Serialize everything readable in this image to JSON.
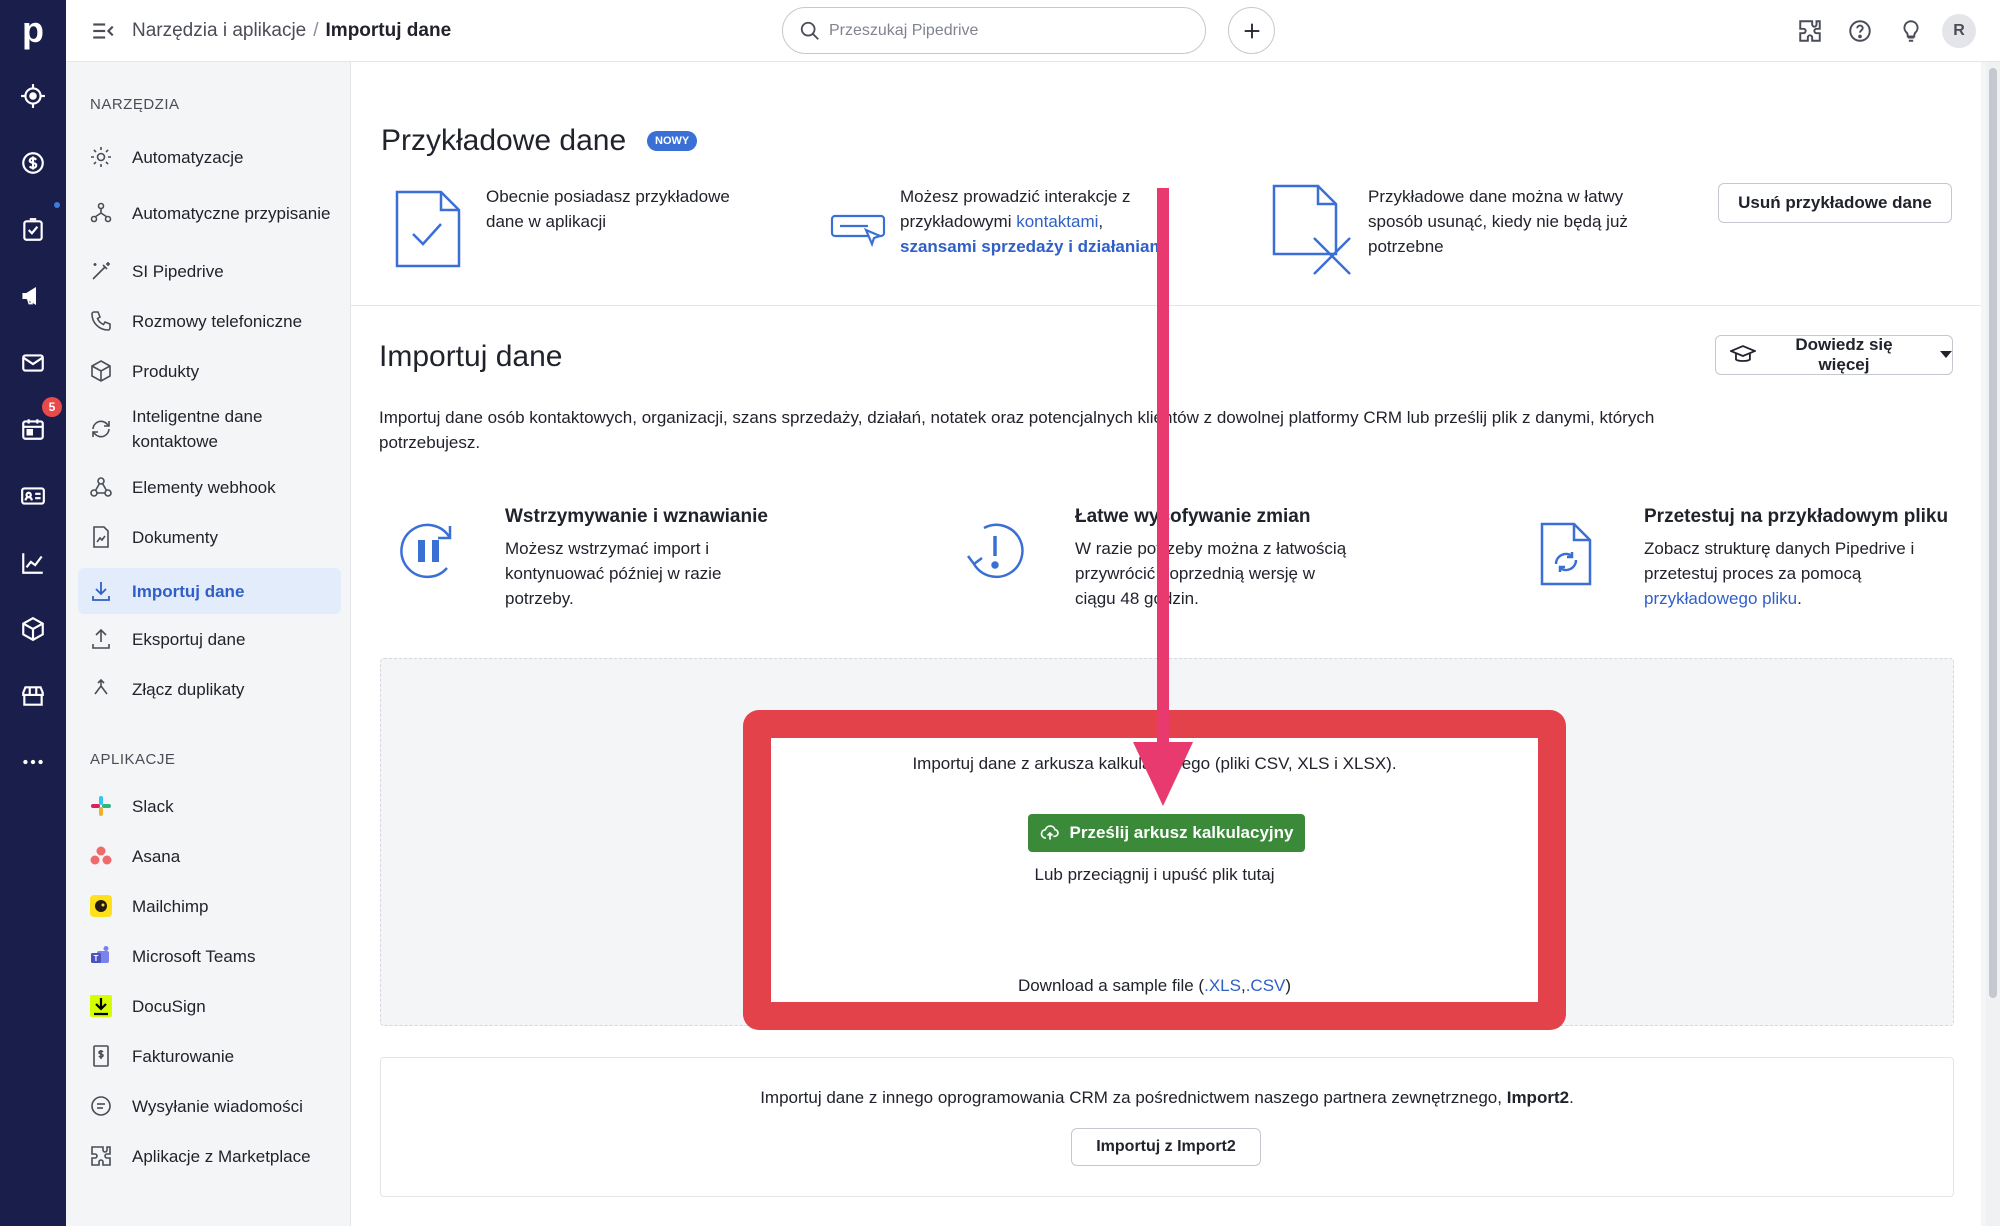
{
  "topbar": {
    "breadcrumb_parent": "Narzędzia i aplikacje",
    "breadcrumb_separator": "/",
    "breadcrumb_current": "Importuj dane",
    "search_placeholder": "Przeszukaj Pipedrive",
    "avatar_initial": "R"
  },
  "rail": {
    "logo": "p",
    "activities_badge": "5",
    "items": [
      "target-icon",
      "deals-icon",
      "tasks-icon",
      "campaigns-icon",
      "mail-icon",
      "calendar-icon",
      "contacts-icon",
      "insights-icon",
      "products-icon",
      "marketplace-icon",
      "more-icon"
    ]
  },
  "sidebar": {
    "tools_title": "NARZĘDZIA",
    "tools": [
      {
        "label": "Automatyzacje",
        "icon": "gear-icon"
      },
      {
        "label": "Automatyczne przypisanie",
        "icon": "assignment-icon"
      },
      {
        "label": "SI Pipedrive",
        "icon": "magic-wand-icon"
      },
      {
        "label": "Rozmowy telefoniczne",
        "icon": "phone-icon"
      },
      {
        "label": "Produkty",
        "icon": "box-icon"
      },
      {
        "label": "Inteligentne dane kontaktowe",
        "icon": "refresh-icon"
      },
      {
        "label": "Elementy webhook",
        "icon": "webhook-icon"
      },
      {
        "label": "Dokumenty",
        "icon": "document-icon"
      },
      {
        "label": "Importuj dane",
        "icon": "download-icon",
        "active": true
      },
      {
        "label": "Eksportuj dane",
        "icon": "upload-icon"
      },
      {
        "label": "Złącz duplikaty",
        "icon": "merge-icon"
      }
    ],
    "apps_title": "APLIKACJE",
    "apps": [
      {
        "label": "Slack",
        "icon": "slack-icon"
      },
      {
        "label": "Asana",
        "icon": "asana-icon"
      },
      {
        "label": "Mailchimp",
        "icon": "mailchimp-icon"
      },
      {
        "label": "Microsoft Teams",
        "icon": "teams-icon"
      },
      {
        "label": "DocuSign",
        "icon": "docusign-icon"
      },
      {
        "label": "Fakturowanie",
        "icon": "invoice-icon"
      },
      {
        "label": "Wysyłanie wiadomości",
        "icon": "chat-icon"
      },
      {
        "label": "Aplikacje z Marketplace",
        "icon": "puzzle-icon"
      }
    ]
  },
  "sample": {
    "title": "Przykładowe dane",
    "badge": "NOWY",
    "col1": "Obecnie posiadasz przykładowe dane w aplikacji",
    "col2_prefix": "Możesz prowadzić interakcje z przykładowymi",
    "col2_link1": "kontaktami",
    "col2_link2": "szansami sprzedaży i działaniami",
    "col3": "Przykładowe dane można w łatwy sposób usunąć, kiedy nie będą już potrzebne",
    "remove_button": "Usuń przykładowe dane"
  },
  "import": {
    "title": "Importuj dane",
    "learn_more": "Dowiedz się więcej",
    "description": "Importuj dane osób kontaktowych, organizacji, szans sprzedaży, działań, notatek oraz potencjalnych klientów z dowolnej platformy CRM lub prześlij plik z danymi, których potrzebujesz.",
    "features": [
      {
        "title": "Wstrzymywanie i wznawianie",
        "text": "Możesz wstrzymać import i kontynuować później w razie potrzeby."
      },
      {
        "title": "Łatwe wycofywanie zmian",
        "text": "W razie potrzeby można z łatwością przywrócić poprzednią wersję w ciągu 48 godzin."
      },
      {
        "title": "Przetestuj na przykładowym pliku",
        "text": "Zobacz strukturę danych Pipedrive i przetestuj proces za pomocą",
        "link": "przykładowego pliku"
      }
    ],
    "dropzone_text": "Importuj dane z arkusza kalkulacyjnego (pliki CSV, XLS i XLSX).",
    "upload_button": "Prześlij arkusz kalkulacyjny",
    "drag_text": "Lub przeciągnij i upuść plik tutaj",
    "sample_prefix": "Download a sample file (",
    "sample_xls": ".XLS",
    "sample_sep": ",",
    "sample_csv": ".CSV",
    "sample_suffix": ")",
    "import2_text": "Importuj dane z innego oprogramowania CRM za pośrednictwem naszego partnera zewnętrznego,",
    "import2_bold": "Import2",
    "import2_button": "Importuj z Import2"
  },
  "colors": {
    "rail": "#1a1e4b",
    "accent": "#2f5fc7",
    "upload_green": "#3a8a3a",
    "highlight_red": "#e3424b",
    "arrow_pink": "#e83a6f"
  }
}
